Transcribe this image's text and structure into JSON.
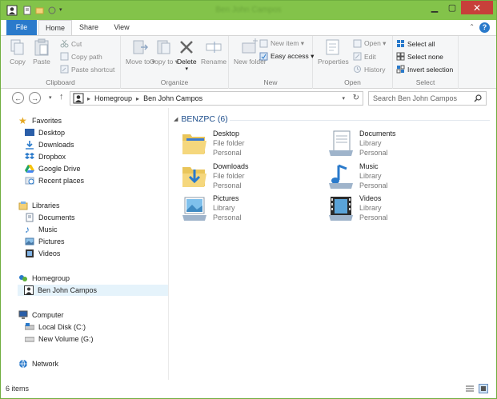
{
  "window": {
    "title": "Ben John Campos"
  },
  "tabs": {
    "file": "File",
    "home": "Home",
    "share": "Share",
    "view": "View"
  },
  "ribbon": {
    "clipboard": {
      "label": "Clipboard",
      "copy": "Copy",
      "paste": "Paste",
      "cut": "Cut",
      "copy_path": "Copy path",
      "paste_shortcut": "Paste shortcut"
    },
    "organize": {
      "label": "Organize",
      "move_to": "Move to ▾",
      "copy_to": "Copy to ▾",
      "delete": "Delete",
      "rename": "Rename"
    },
    "new": {
      "label": "New",
      "new_folder": "New folder",
      "new_item": "New item ▾",
      "easy_access": "Easy access ▾"
    },
    "open": {
      "label": "Open",
      "properties": "Properties",
      "open": "Open ▾",
      "edit": "Edit",
      "history": "History"
    },
    "select": {
      "label": "Select",
      "select_all": "Select all",
      "select_none": "Select none",
      "invert_selection": "Invert selection"
    }
  },
  "address": {
    "crumbs": [
      "Homegroup",
      "Ben John Campos"
    ],
    "search_placeholder": "Search Ben John Campos"
  },
  "nav": {
    "favorites": "Favorites",
    "fav_items": [
      "Desktop",
      "Downloads",
      "Dropbox",
      "Google Drive",
      "Recent places"
    ],
    "libraries": "Libraries",
    "lib_items": [
      "Documents",
      "Music",
      "Pictures",
      "Videos"
    ],
    "homegroup": "Homegroup",
    "homegroup_user": "Ben John Campos",
    "computer": "Computer",
    "drives": [
      "Local Disk (C:)",
      "New Volume (G:)"
    ],
    "network": "Network"
  },
  "content": {
    "group_name": "BENZPC (6)",
    "items": [
      {
        "name": "Desktop",
        "type": "File folder",
        "owner": "Personal"
      },
      {
        "name": "Documents",
        "type": "Library",
        "owner": "Personal"
      },
      {
        "name": "Downloads",
        "type": "File folder",
        "owner": "Personal"
      },
      {
        "name": "Music",
        "type": "Library",
        "owner": "Personal"
      },
      {
        "name": "Pictures",
        "type": "Library",
        "owner": "Personal"
      },
      {
        "name": "Videos",
        "type": "Library",
        "owner": "Personal"
      }
    ]
  },
  "status": {
    "count": "6 items"
  },
  "colors": {
    "titlebar": "#83c34a",
    "file_tab": "#2a7acb",
    "accent_text": "#1e4e8c",
    "close": "#c7403a"
  }
}
